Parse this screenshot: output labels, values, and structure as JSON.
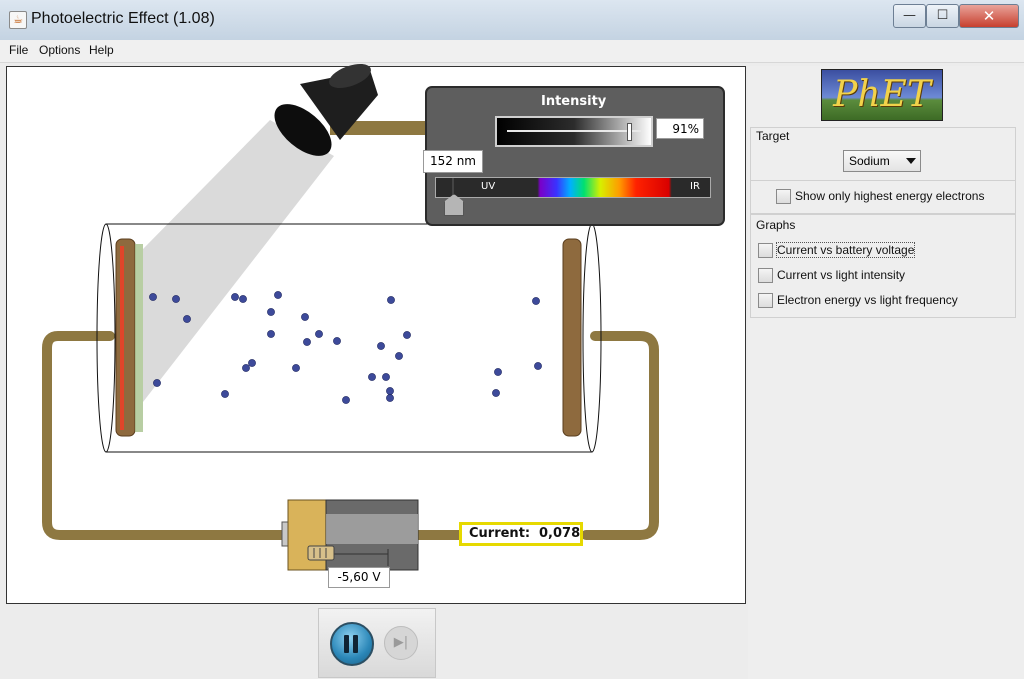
{
  "window": {
    "title": "Photoelectric Effect (1.08)",
    "minimize_label": "—",
    "maximize_label": "☐",
    "close_label": "✕",
    "app_icon": "java-icon"
  },
  "menu": {
    "file": "File",
    "options": "Options",
    "help": "Help"
  },
  "light_control": {
    "intensity_title": "Intensity",
    "intensity_value": "91%",
    "intensity_fraction": 0.91,
    "wavelength_value": "152 nm",
    "uv_label": "UV",
    "ir_label": "IR"
  },
  "circuit": {
    "current_label": "Current:",
    "current_value": "0,078",
    "voltage_value": "-5,60 V"
  },
  "sidebar": {
    "logo_text": "PhET",
    "target": {
      "title": "Target",
      "selected": "Sodium",
      "show_highest_label": "Show only highest energy electrons"
    },
    "graphs": {
      "title": "Graphs",
      "items": [
        {
          "label": "Current vs battery voltage",
          "checked": false
        },
        {
          "label": "Current vs light intensity",
          "checked": false
        },
        {
          "label": "Electron energy vs light frequency",
          "checked": false
        }
      ]
    }
  },
  "controls": {
    "pause_icon": "pause-icon",
    "step_icon": "step-forward-icon"
  },
  "colors": {
    "wire": "#8e7841",
    "electron": "#3d4a9a",
    "plate": "#8e6a3e",
    "highlight": "#e6d900"
  }
}
